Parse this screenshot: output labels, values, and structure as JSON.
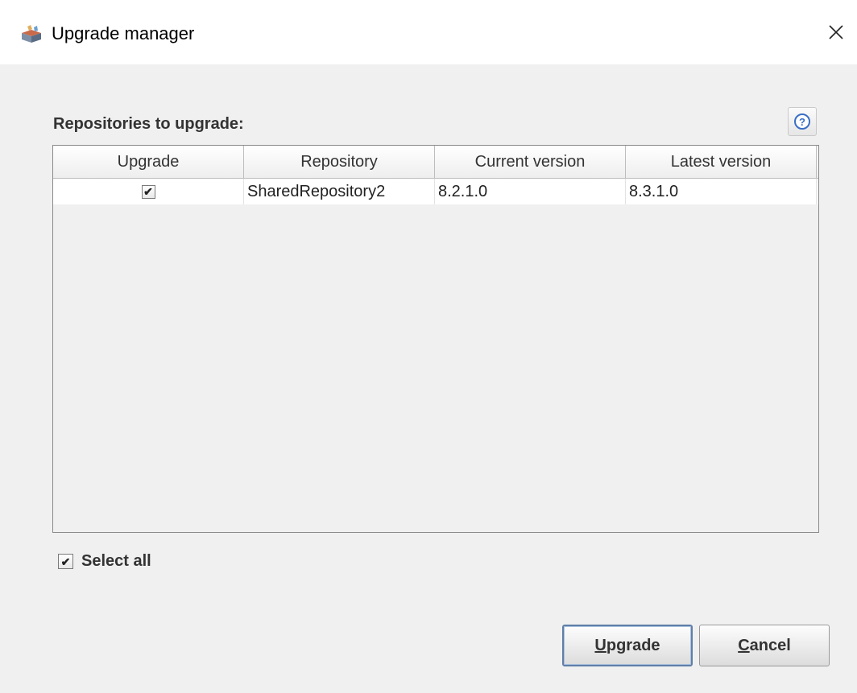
{
  "window": {
    "title": "Upgrade manager",
    "icon": "app-icon"
  },
  "section": {
    "label": "Repositories to upgrade:"
  },
  "table": {
    "columns": [
      "Upgrade",
      "Repository",
      "Current version",
      "Latest version"
    ],
    "rows": [
      {
        "upgrade_checked": "✔",
        "repository": "SharedRepository2",
        "current_version": "8.2.1.0",
        "latest_version": "8.3.1.0"
      }
    ]
  },
  "select_all": {
    "label": "Select all",
    "checked_mark": "✔"
  },
  "buttons": {
    "upgrade_mnemonic": "U",
    "upgrade_rest": "pgrade",
    "cancel_mnemonic": "C",
    "cancel_rest": "ancel"
  },
  "colors": {
    "background": "#f0f0f0",
    "default_button_border": "#5f7fa8",
    "help_icon": "#3a6fc4"
  }
}
